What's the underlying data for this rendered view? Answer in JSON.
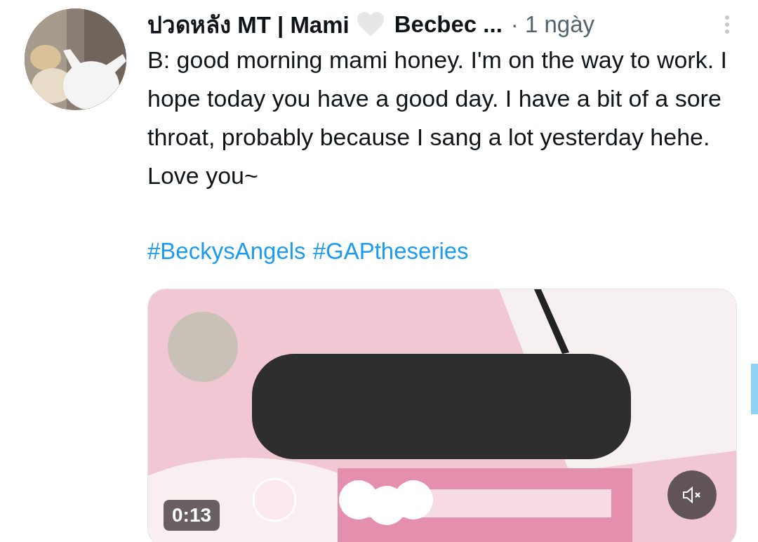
{
  "tweet": {
    "author_name": "ปวดหลัง MT | Mami",
    "author_name_rest": "Becbec ...",
    "time": "· 1 ngày",
    "text": "B: good morning mami honey. I'm on the way to work. I hope today you have a good day. I have a bit of a sore throat, probably because I sang a lot yesterday hehe. Love you~",
    "hashtags": [
      "#BeckysAngels",
      "#GAPtheseries"
    ],
    "video": {
      "kind": "picture",
      "duration": "0:13",
      "muted": true
    }
  }
}
